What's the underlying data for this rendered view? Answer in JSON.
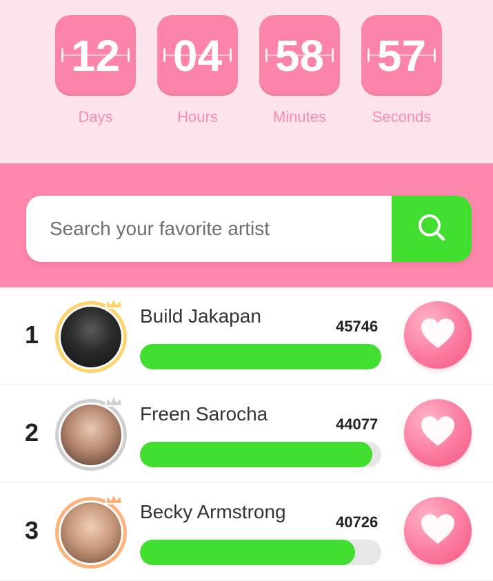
{
  "countdown": {
    "units": [
      {
        "value": "12",
        "label": "Days"
      },
      {
        "value": "04",
        "label": "Hours"
      },
      {
        "value": "58",
        "label": "Minutes"
      },
      {
        "value": "57",
        "label": "Seconds"
      }
    ]
  },
  "search": {
    "placeholder": "Search your favorite artist",
    "icon": "search-icon"
  },
  "ranking": [
    {
      "rank": "1",
      "name": "Build Jakapan",
      "votes": "45746",
      "progress": 1.0,
      "ring_color": "#ffd36b",
      "crown_color": "#ffd36b"
    },
    {
      "rank": "2",
      "name": "Freen Sarocha",
      "votes": "44077",
      "progress": 0.964,
      "ring_color": "#cfcfcf",
      "crown_color": "#cfcfcf"
    },
    {
      "rank": "3",
      "name": "Becky Armstrong",
      "votes": "40726",
      "progress": 0.89,
      "ring_color": "#ffb27a",
      "crown_color": "#ffb27a"
    }
  ],
  "colors": {
    "tile": "#fb84a8",
    "accent_green": "#41dd2f",
    "band_pink": "#fd88ac",
    "light_pink": "#fde3ec"
  }
}
